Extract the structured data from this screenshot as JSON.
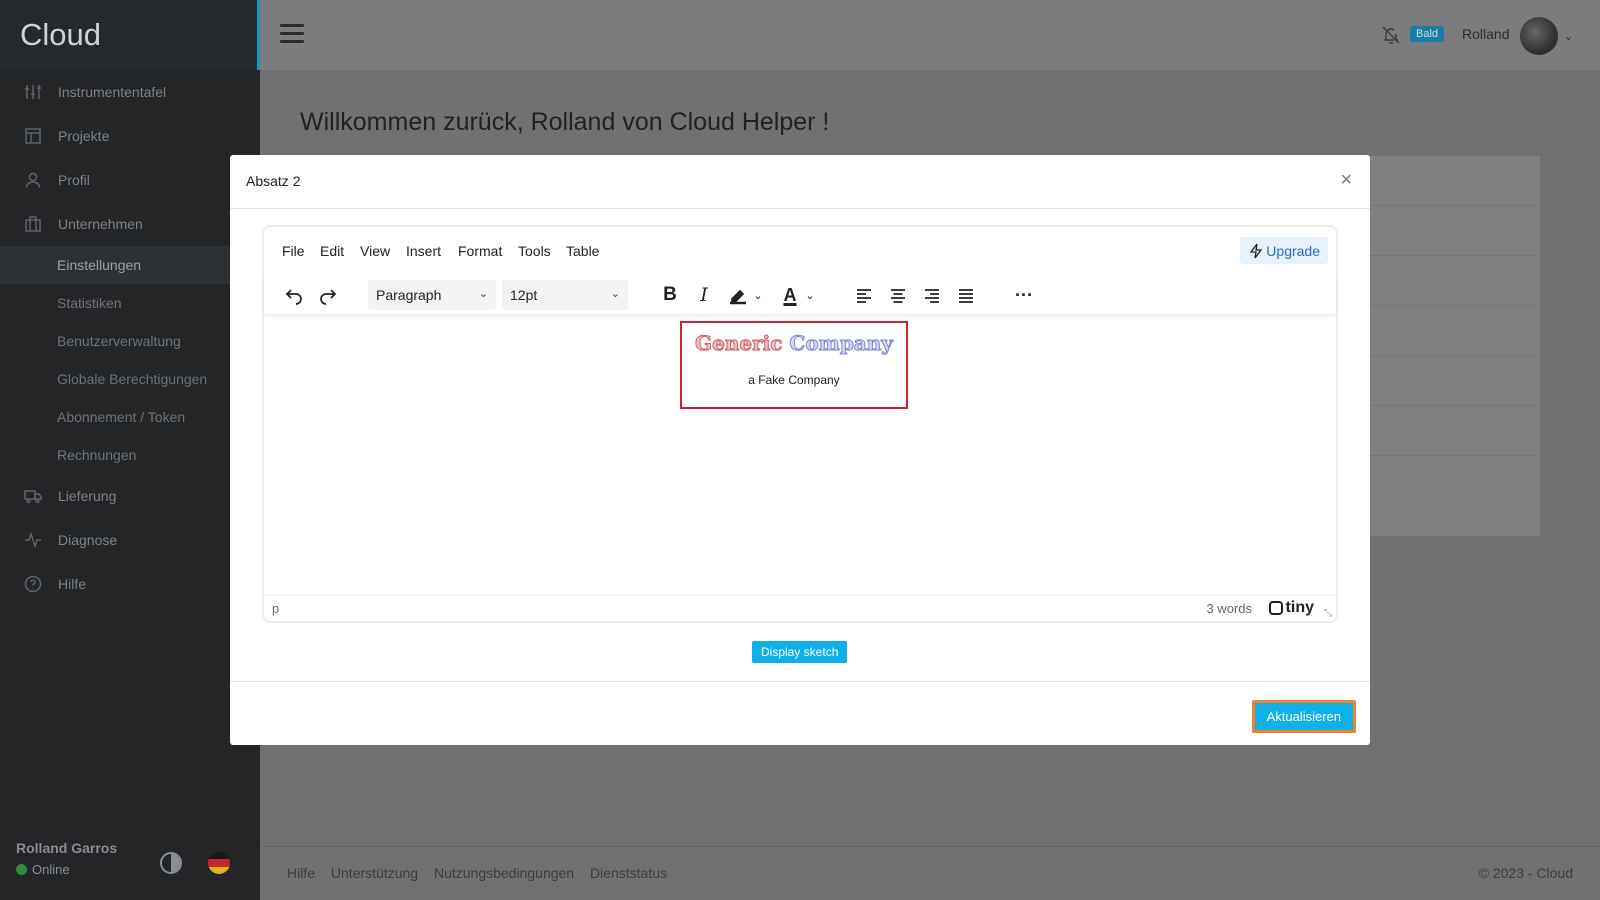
{
  "sidebar": {
    "brand": "Cloud",
    "items": [
      {
        "label": "Instrumententafel",
        "icon": "sliders-icon"
      },
      {
        "label": "Projekte",
        "icon": "layout-icon"
      },
      {
        "label": "Profil",
        "icon": "user-icon"
      },
      {
        "label": "Unternehmen",
        "icon": "briefcase-icon"
      }
    ],
    "subitems": [
      "Einstellungen",
      "Statistiken",
      "Benutzerverwaltung",
      "Globale Berechtigungen",
      "Abonnement / Token",
      "Rechnungen"
    ],
    "items2": [
      {
        "label": "Lieferung",
        "icon": "truck-icon"
      },
      {
        "label": "Diagnose",
        "icon": "activity-icon"
      },
      {
        "label": "Hilfe",
        "icon": "help-icon"
      }
    ],
    "user_name": "Rolland Garros",
    "user_status": "Online"
  },
  "topbar": {
    "badge": "Bald",
    "user": "Rolland"
  },
  "main": {
    "welcome": "Willkommen zurück, Rolland von Cloud Helper !"
  },
  "footer": {
    "links": [
      "Hilfe",
      "Unterstützung",
      "Nutzungsbedingungen",
      "Dienststatus"
    ],
    "copyright": "© 2023 - Cloud"
  },
  "modal": {
    "title": "Absatz 2",
    "close": "×",
    "editor": {
      "menu": [
        "File",
        "Edit",
        "View",
        "Insert",
        "Format",
        "Tools",
        "Table"
      ],
      "upgrade": "Upgrade",
      "block_format": "Paragraph",
      "font_size": "12pt",
      "logo_word1": "Generic",
      "logo_word2": "Company",
      "logo_sub": "a Fake Company",
      "path": "p",
      "word_count": "3 words",
      "brand": "tiny"
    },
    "sketch_button": "Display sketch",
    "update_button": "Aktualisieren"
  },
  "colors": {
    "accent": "#0fb0e8",
    "focus_border": "#f0832d",
    "logo_border": "#c8262c"
  }
}
